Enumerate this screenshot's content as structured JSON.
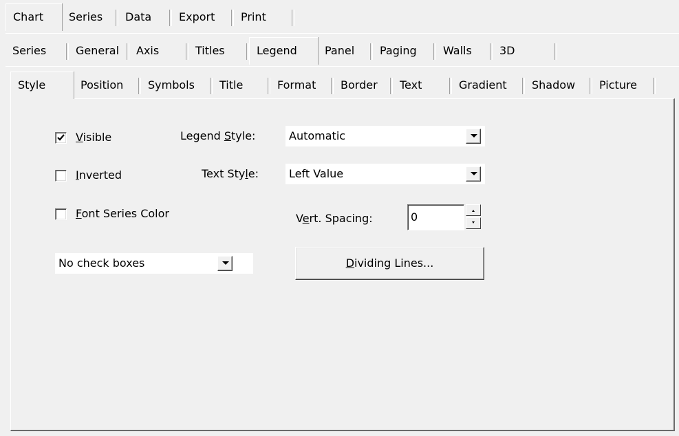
{
  "tabs_row1": [
    "Chart",
    "Series",
    "Data",
    "Export",
    "Print"
  ],
  "tabs_row2": [
    "Series",
    "General",
    "Axis",
    "Titles",
    "Legend",
    "Panel",
    "Paging",
    "Walls",
    "3D"
  ],
  "tabs_row3": [
    "Style",
    "Position",
    "Symbols",
    "Title",
    "Format",
    "Border",
    "Text",
    "Gradient",
    "Shadow",
    "Picture"
  ],
  "active": {
    "row1": "Chart",
    "row2": "Legend",
    "row3": "Style"
  },
  "options": {
    "visible": {
      "label_mn": "V",
      "label_rest": "isible",
      "checked": true
    },
    "inverted": {
      "label_mn": "I",
      "label_rest": "nverted",
      "checked": false
    },
    "font_series_color": {
      "label_mn": "F",
      "label_rest": "ont Series Color",
      "checked": false
    }
  },
  "legend_style": {
    "label_pre": "Legend ",
    "label_mn": "S",
    "label_post": "tyle:",
    "value": "Automatic"
  },
  "text_style": {
    "label_pre": "Text Sty",
    "label_mn": "l",
    "label_post": "e:",
    "value": "Left Value"
  },
  "vert_spacing": {
    "label_pre": "V",
    "label_mn": "e",
    "label_post": "rt. Spacing:",
    "value": "0"
  },
  "check_boxes": {
    "value": "No check boxes"
  },
  "dividing_lines": {
    "label_mn": "D",
    "label_rest": "ividing Lines..."
  }
}
